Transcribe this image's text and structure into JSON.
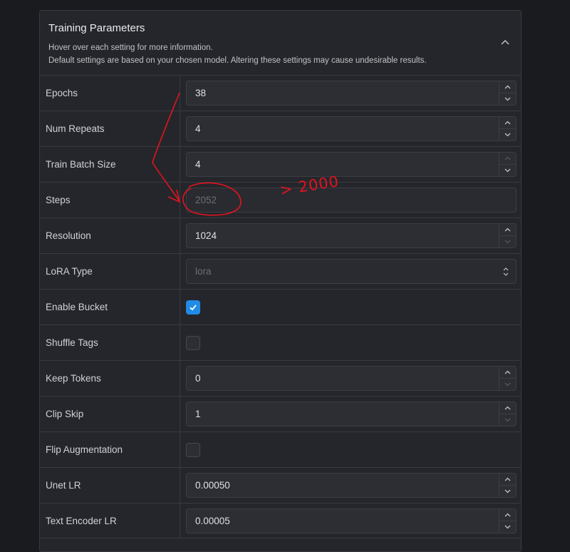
{
  "panel": {
    "title": "Training Parameters",
    "description_line1": "Hover over each setting for more information.",
    "description_line2": "Default settings are based on your chosen model. Altering these settings may cause undesirable results.",
    "collapse_icon": "chevron-up-icon"
  },
  "rows": [
    {
      "label": "Epochs",
      "type": "number",
      "value": "38",
      "up_enabled": true,
      "down_enabled": true
    },
    {
      "label": "Num Repeats",
      "type": "number",
      "value": "4",
      "up_enabled": true,
      "down_enabled": true
    },
    {
      "label": "Train Batch Size",
      "type": "number",
      "value": "4",
      "up_enabled": false,
      "down_enabled": true
    },
    {
      "label": "Steps",
      "type": "readonly",
      "value": "2052"
    },
    {
      "label": "Resolution",
      "type": "number",
      "value": "1024",
      "up_enabled": true,
      "down_enabled": false
    },
    {
      "label": "LoRA Type",
      "type": "select",
      "value": "lora"
    },
    {
      "label": "Enable Bucket",
      "type": "checkbox",
      "checked": true
    },
    {
      "label": "Shuffle Tags",
      "type": "checkbox",
      "checked": false
    },
    {
      "label": "Keep Tokens",
      "type": "number",
      "value": "0",
      "up_enabled": true,
      "down_enabled": false
    },
    {
      "label": "Clip Skip",
      "type": "number",
      "value": "1",
      "up_enabled": true,
      "down_enabled": false
    },
    {
      "label": "Flip Augmentation",
      "type": "checkbox",
      "checked": false
    },
    {
      "label": "Unet LR",
      "type": "number",
      "value": "0.00050",
      "up_enabled": true,
      "down_enabled": true
    },
    {
      "label": "Text Encoder LR",
      "type": "number",
      "value": "0.00005",
      "up_enabled": true,
      "down_enabled": true
    }
  ],
  "annotation": {
    "text": "> 2000",
    "color": "#e3131f"
  },
  "colors": {
    "accent": "#228be6",
    "background": "#1a1b1e",
    "panel": "#25262b"
  }
}
